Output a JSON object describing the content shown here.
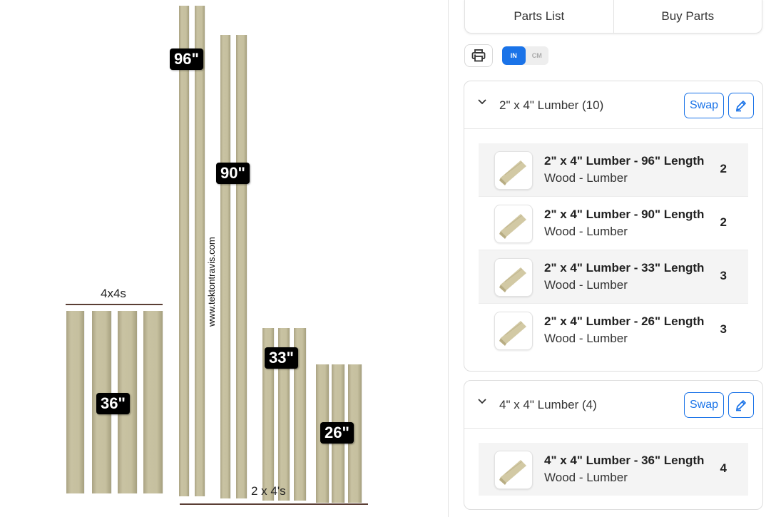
{
  "diagram": {
    "group_4x4_label": "4x4s",
    "group_2x4_label": "2 x 4's",
    "watermark": "www.tektontravis.com",
    "labels": {
      "l96": "96\"",
      "l90": "90\"",
      "l33": "33\"",
      "l26": "26\"",
      "l36": "36\""
    },
    "board_color": "#c6c09f",
    "line_color": "#5a3e34"
  },
  "tabs": {
    "parts_list": "Parts List",
    "buy_parts": "Buy Parts"
  },
  "toolbar": {
    "print_icon": "printer-icon",
    "unit_in": "IN",
    "unit_cm": "CM",
    "active_unit": "IN"
  },
  "groups": [
    {
      "title": "2\" x 4\" Lumber (10)",
      "swap_label": "Swap",
      "items": [
        {
          "name": "2\" x 4\" Lumber - 96\" Length",
          "sub": "Wood - Lumber",
          "qty": "2"
        },
        {
          "name": "2\" x 4\" Lumber - 90\" Length",
          "sub": "Wood - Lumber",
          "qty": "2"
        },
        {
          "name": "2\" x 4\" Lumber - 33\" Length",
          "sub": "Wood - Lumber",
          "qty": "3"
        },
        {
          "name": "2\" x 4\" Lumber - 26\" Length",
          "sub": "Wood - Lumber",
          "qty": "3"
        }
      ]
    },
    {
      "title": "4\" x 4\" Lumber (4)",
      "swap_label": "Swap",
      "items": [
        {
          "name": "4\" x 4\" Lumber - 36\" Length",
          "sub": "Wood - Lumber",
          "qty": "4"
        }
      ]
    }
  ],
  "colors": {
    "accent": "#1a73e8"
  }
}
